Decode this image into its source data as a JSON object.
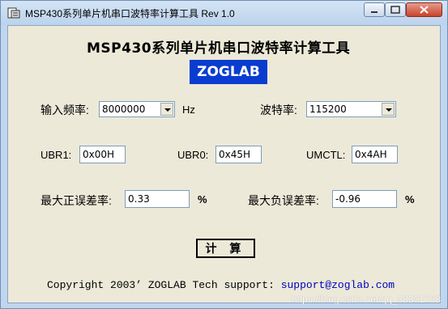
{
  "window": {
    "title": "MSP430系列单片机串口波特率计算工具 Rev 1.0"
  },
  "heading": "MSP430系列单片机串口波特率计算工具",
  "logo": "ZOGLAB",
  "freq": {
    "label": "输入频率:",
    "value": "8000000",
    "unit": "Hz"
  },
  "baud": {
    "label": "波特率:",
    "value": "115200"
  },
  "ubr1": {
    "label": "UBR1:",
    "value": "0x00H"
  },
  "ubr0": {
    "label": "UBR0:",
    "value": "0x45H"
  },
  "umctl": {
    "label": "UMCTL:",
    "value": "0x4AH"
  },
  "maxPos": {
    "label": "最大正误差率:",
    "value": "0.33",
    "unit": "%"
  },
  "maxNeg": {
    "label": "最大负误差率:",
    "value": "-0.96",
    "unit": "%"
  },
  "calcButton": "计  算",
  "footer": {
    "copyright": "Copyright 2003’ ZOGLAB",
    "support_label": "Tech support:",
    "email": "support@zoglab.com"
  },
  "watermark": "https://blog.csdn.net/qq_38301758",
  "icons": [
    "app-icon",
    "minimize-icon",
    "maximize-icon",
    "close-icon",
    "dropdown-arrow-icon"
  ]
}
